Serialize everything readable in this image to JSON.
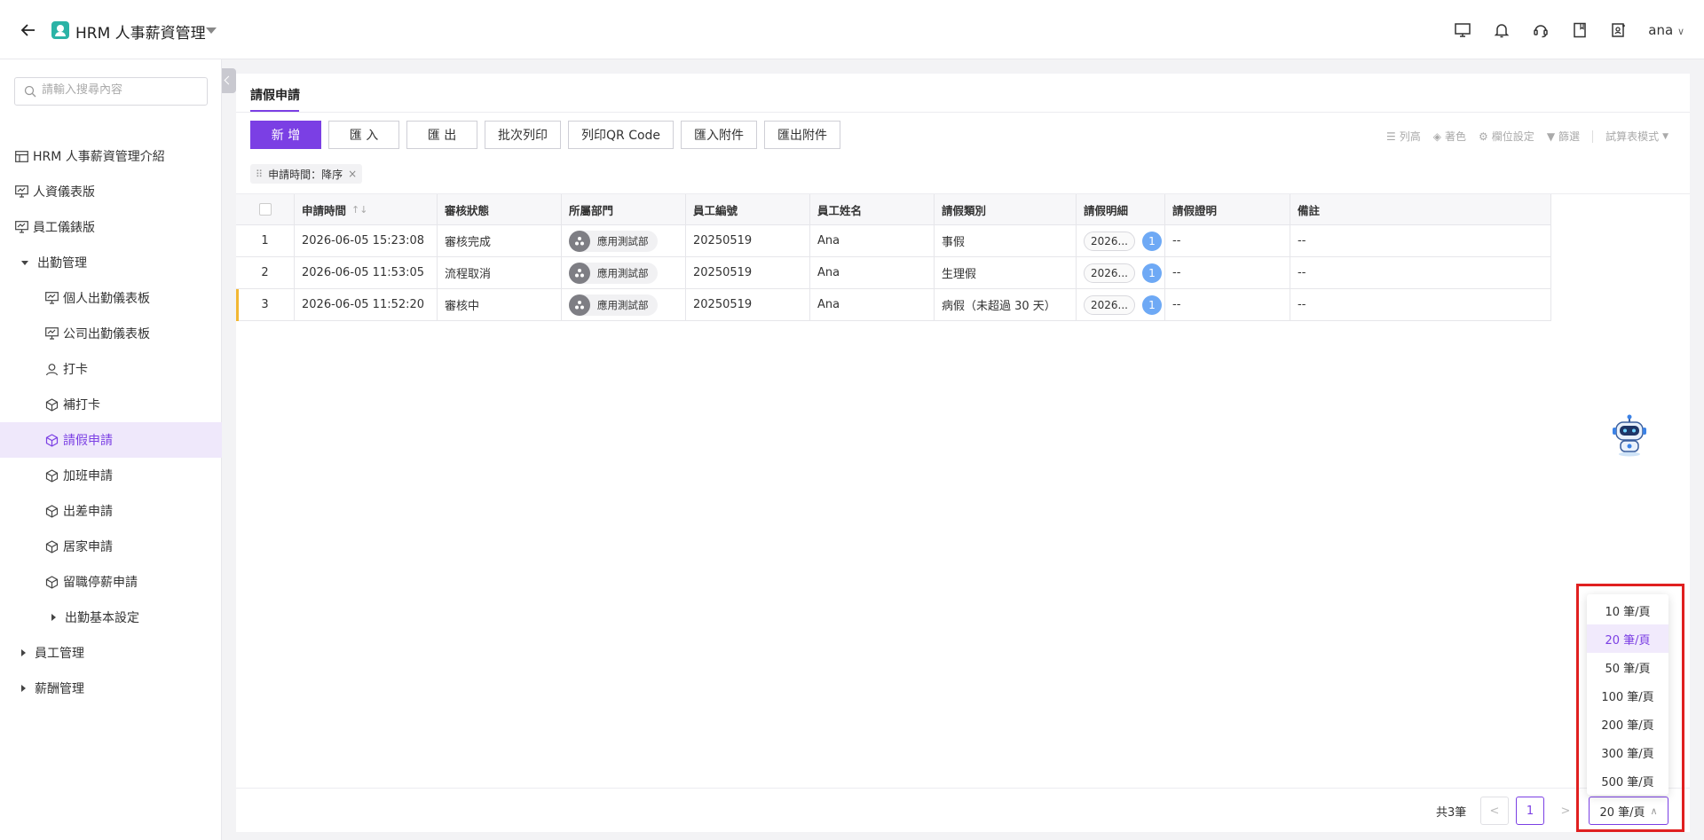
{
  "header": {
    "title": "HRM 人事薪資管理",
    "user": "ana",
    "icons": [
      "monitor-icon",
      "bell-icon",
      "headset-icon",
      "book-icon",
      "user-edit-icon"
    ]
  },
  "sidebar": {
    "search_placeholder": "請輸入搜尋內容",
    "items": [
      {
        "label": "HRM 人事薪資管理介紹"
      },
      {
        "label": "人資儀表版"
      },
      {
        "label": "員工儀錶版"
      },
      {
        "label": "出勤管理"
      },
      {
        "label": "個人出勤儀表板"
      },
      {
        "label": "公司出勤儀表板"
      },
      {
        "label": "打卡"
      },
      {
        "label": "補打卡"
      },
      {
        "label": "請假申請"
      },
      {
        "label": "加班申請"
      },
      {
        "label": "出差申請"
      },
      {
        "label": "居家申請"
      },
      {
        "label": "留職停薪申請"
      },
      {
        "label": "出勤基本設定"
      },
      {
        "label": "員工管理"
      },
      {
        "label": "薪酬管理"
      }
    ]
  },
  "main": {
    "tab": "請假申請",
    "toolbar": {
      "add": "新 增",
      "import": "匯 入",
      "export": "匯 出",
      "batch_print": "批次列印",
      "print_qr": "列印QR Code",
      "import_attachment": "匯入附件",
      "export_attachment": "匯出附件"
    },
    "right_tools": {
      "row_height": "列高",
      "color": "著色",
      "column_settings": "欄位設定",
      "filter": "篩選",
      "sheet_mode": "試算表模式"
    },
    "sort_chip": "申請時間：降序",
    "table": {
      "headers": [
        "申請時間",
        "審核狀態",
        "所屬部門",
        "員工編號",
        "員工姓名",
        "請假類別",
        "請假明細",
        "請假證明",
        "備註"
      ],
      "rows": [
        {
          "no": "1",
          "time": "2026-06-05 15:23:08",
          "status": "審核完成",
          "dept": "應用測試部",
          "emp_id": "20250519",
          "name": "Ana",
          "type": "事假",
          "detail": "2026...",
          "count": "1",
          "proof": "--",
          "note": "--"
        },
        {
          "no": "2",
          "time": "2026-06-05 11:53:05",
          "status": "流程取消",
          "dept": "應用測試部",
          "emp_id": "20250519",
          "name": "Ana",
          "type": "生理假",
          "detail": "2026...",
          "count": "1",
          "proof": "--",
          "note": "--"
        },
        {
          "no": "3",
          "time": "2026-06-05 11:52:20",
          "status": "審核中",
          "dept": "應用測試部",
          "emp_id": "20250519",
          "name": "Ana",
          "type": "病假（未超過 30 天）",
          "detail": "2026...",
          "count": "1",
          "proof": "--",
          "note": "--"
        }
      ]
    }
  },
  "pagination": {
    "total": "共3筆",
    "prev": "<",
    "current_page": "1",
    "next": ">",
    "page_size": "20 筆/頁",
    "options": [
      "10 筆/頁",
      "20 筆/頁",
      "50 筆/頁",
      "100 筆/頁",
      "200 筆/頁",
      "300 筆/頁",
      "500 筆/頁"
    ],
    "selected_option": "20 筆/頁"
  },
  "colors": {
    "accent": "#7b3fe4",
    "highlight": "#e02020",
    "badge": "#6ea9f5",
    "row_marker": "#f2b733"
  }
}
